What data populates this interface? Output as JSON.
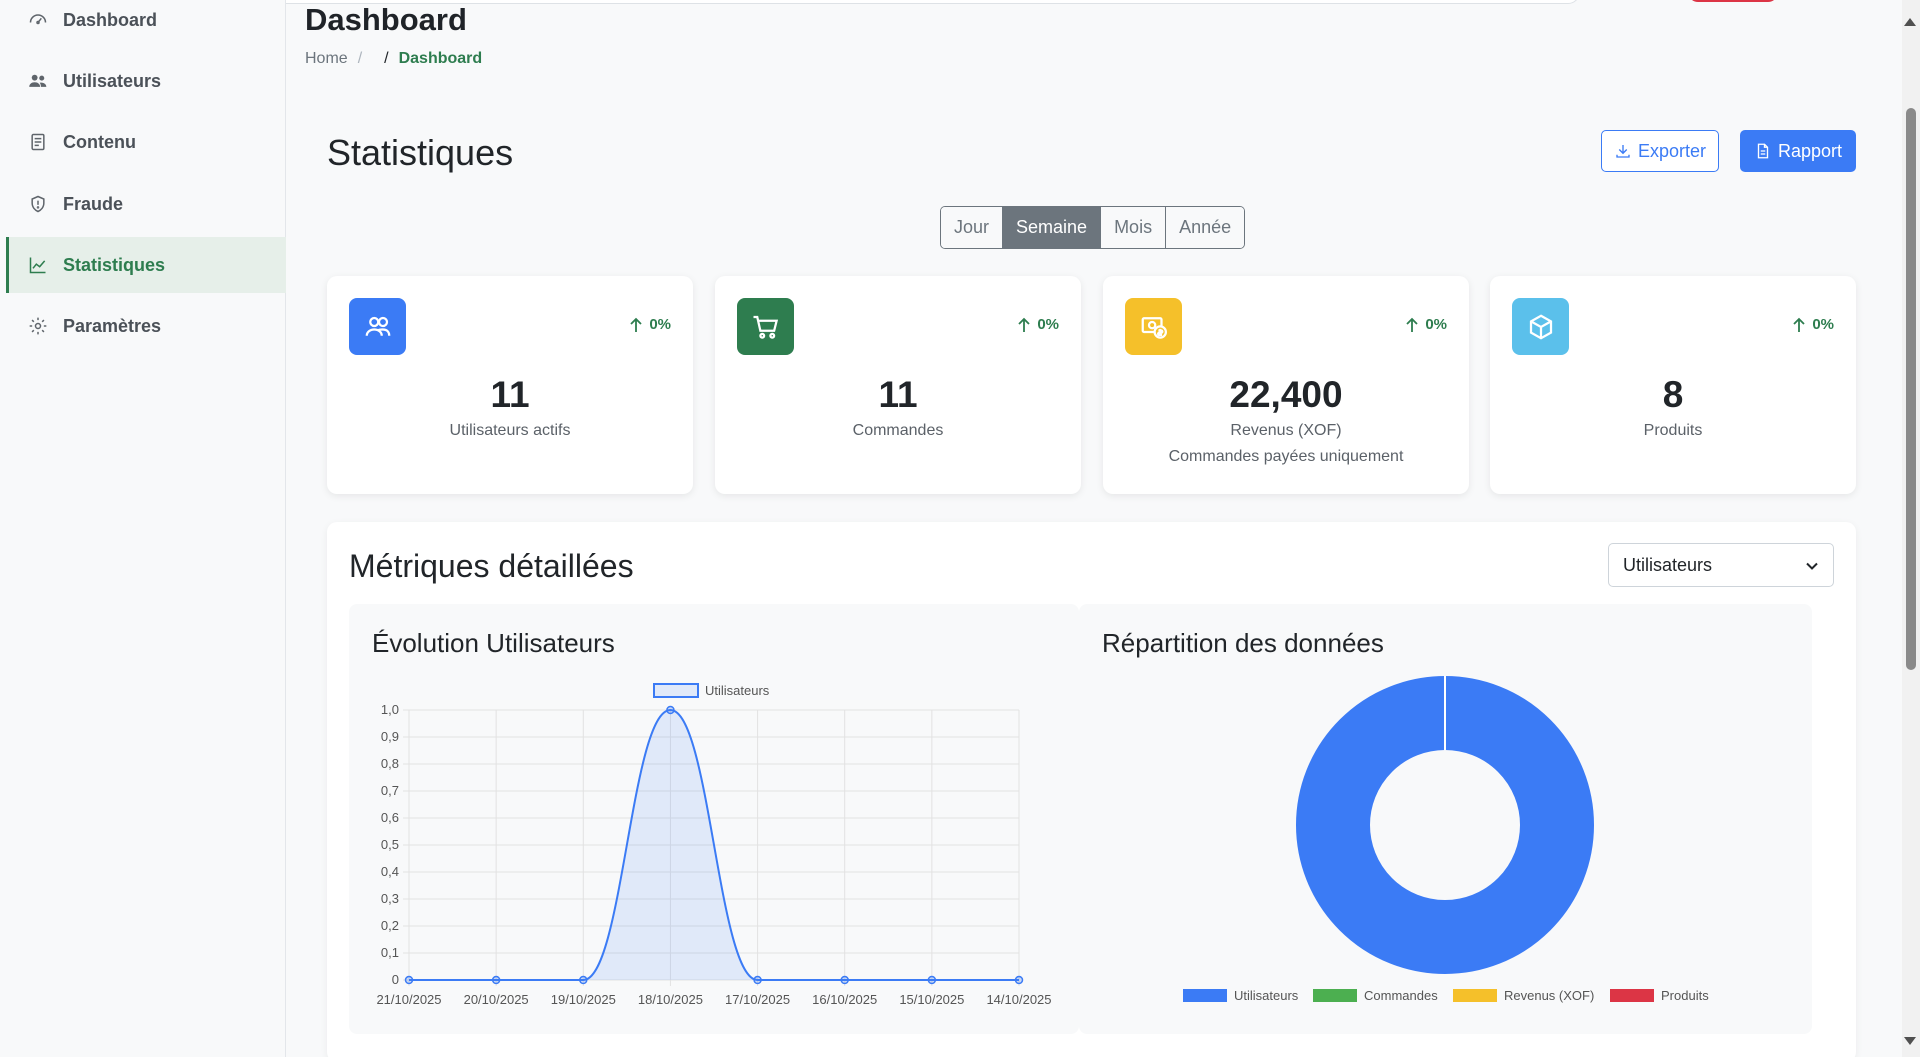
{
  "sidebar": {
    "items": [
      {
        "label": "Dashboard",
        "icon": "gauge-icon"
      },
      {
        "label": "Utilisateurs",
        "icon": "users-icon"
      },
      {
        "label": "Contenu",
        "icon": "document-icon"
      },
      {
        "label": "Fraude",
        "icon": "shield-icon"
      },
      {
        "label": "Statistiques",
        "icon": "chart-line-icon",
        "active": true
      },
      {
        "label": "Paramètres",
        "icon": "gear-icon"
      }
    ]
  },
  "header": {
    "title": "Dashboard",
    "breadcrumb": {
      "home": "Home",
      "separator": "/",
      "current": "Dashboard"
    }
  },
  "stats": {
    "title": "Statistiques",
    "export_label": "Exporter",
    "report_label": "Rapport",
    "periods": [
      "Jour",
      "Semaine",
      "Mois",
      "Année"
    ],
    "active_period": "Semaine"
  },
  "kpis": [
    {
      "value": "11",
      "label": "Utilisateurs actifs",
      "sub": "",
      "change": "0%",
      "color": "#3b7bf5",
      "icon": "users-icon"
    },
    {
      "value": "11",
      "label": "Commandes",
      "sub": "",
      "change": "0%",
      "color": "#2e7d4f",
      "icon": "cart-icon"
    },
    {
      "value": "22,400",
      "label": "Revenus (XOF)",
      "sub": "Commandes payées uniquement",
      "change": "0%",
      "color": "#f5c02a",
      "icon": "money-icon"
    },
    {
      "value": "8",
      "label": "Produits",
      "sub": "",
      "change": "0%",
      "color": "#5bc0eb",
      "icon": "box-icon"
    }
  ],
  "metrics": {
    "title": "Métriques détaillées",
    "select_value": "Utilisateurs"
  },
  "colors": {
    "primary": "#3b7bf5",
    "success": "#2e7d4f",
    "warning": "#f5c02a",
    "info": "#5bc0eb",
    "danger": "#dc3545",
    "commandes_series": "#4caf50"
  },
  "chart_data": [
    {
      "type": "line",
      "title": "Évolution Utilisateurs",
      "categories": [
        "21/10/2025",
        "20/10/2025",
        "19/10/2025",
        "18/10/2025",
        "17/10/2025",
        "16/10/2025",
        "15/10/2025",
        "14/10/2025"
      ],
      "series": [
        {
          "name": "Utilisateurs",
          "values": [
            0,
            0,
            0,
            1,
            0,
            0,
            0,
            0
          ]
        }
      ],
      "ylim": [
        0,
        1
      ],
      "yticks": [
        "0",
        "0,1",
        "0,2",
        "0,3",
        "0,4",
        "0,5",
        "0,6",
        "0,7",
        "0,8",
        "0,9",
        "1,0"
      ],
      "grid": true,
      "legend": "top"
    },
    {
      "type": "pie",
      "title": "Répartition des données",
      "categories": [
        "Utilisateurs",
        "Commandes",
        "Revenus (XOF)",
        "Produits"
      ],
      "values": [
        100,
        0,
        0,
        0
      ],
      "legend": "bottom"
    }
  ]
}
